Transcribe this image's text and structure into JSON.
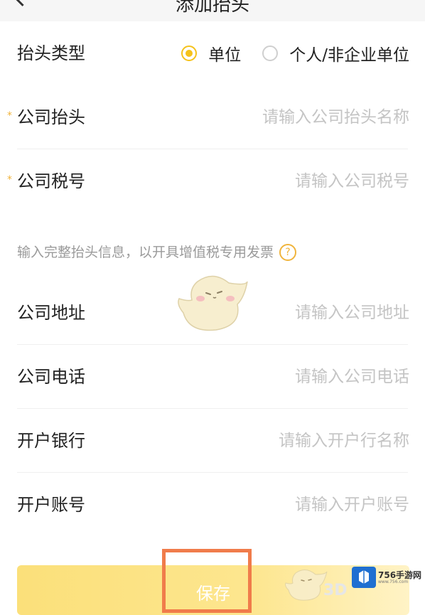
{
  "navbar": {
    "title": "添加抬头"
  },
  "form": {
    "type": {
      "label": "抬头类型",
      "options": [
        {
          "label": "单位",
          "selected": true
        },
        {
          "label": "个人/非企业单位",
          "selected": false
        }
      ]
    },
    "company_name": {
      "label": "公司抬头",
      "required_mark": "*",
      "placeholder": "请输入公司抬头名称",
      "value": ""
    },
    "tax_id": {
      "label": "公司税号",
      "required_mark": "*",
      "placeholder": "请输入公司税号",
      "value": ""
    },
    "hint": "输入完整抬头信息，以开具增值税专用发票",
    "help_icon": "?",
    "address": {
      "label": "公司地址",
      "placeholder": "请输入公司地址",
      "value": ""
    },
    "phone": {
      "label": "公司电话",
      "placeholder": "请输入公司电话",
      "value": ""
    },
    "bank": {
      "label": "开户银行",
      "placeholder": "请输入开户行名称",
      "value": ""
    },
    "account": {
      "label": "开户账号",
      "placeholder": "请输入开户账号",
      "value": ""
    }
  },
  "save_button": {
    "label": "保存"
  },
  "watermark": {
    "site_name": "756手游网",
    "site_url": "www.756.com",
    "brand_text": "3D"
  },
  "colors": {
    "accent": "#f5c21b",
    "required": "#f0b43c",
    "highlight": "#f07c4b",
    "button": "#fbe07a"
  }
}
